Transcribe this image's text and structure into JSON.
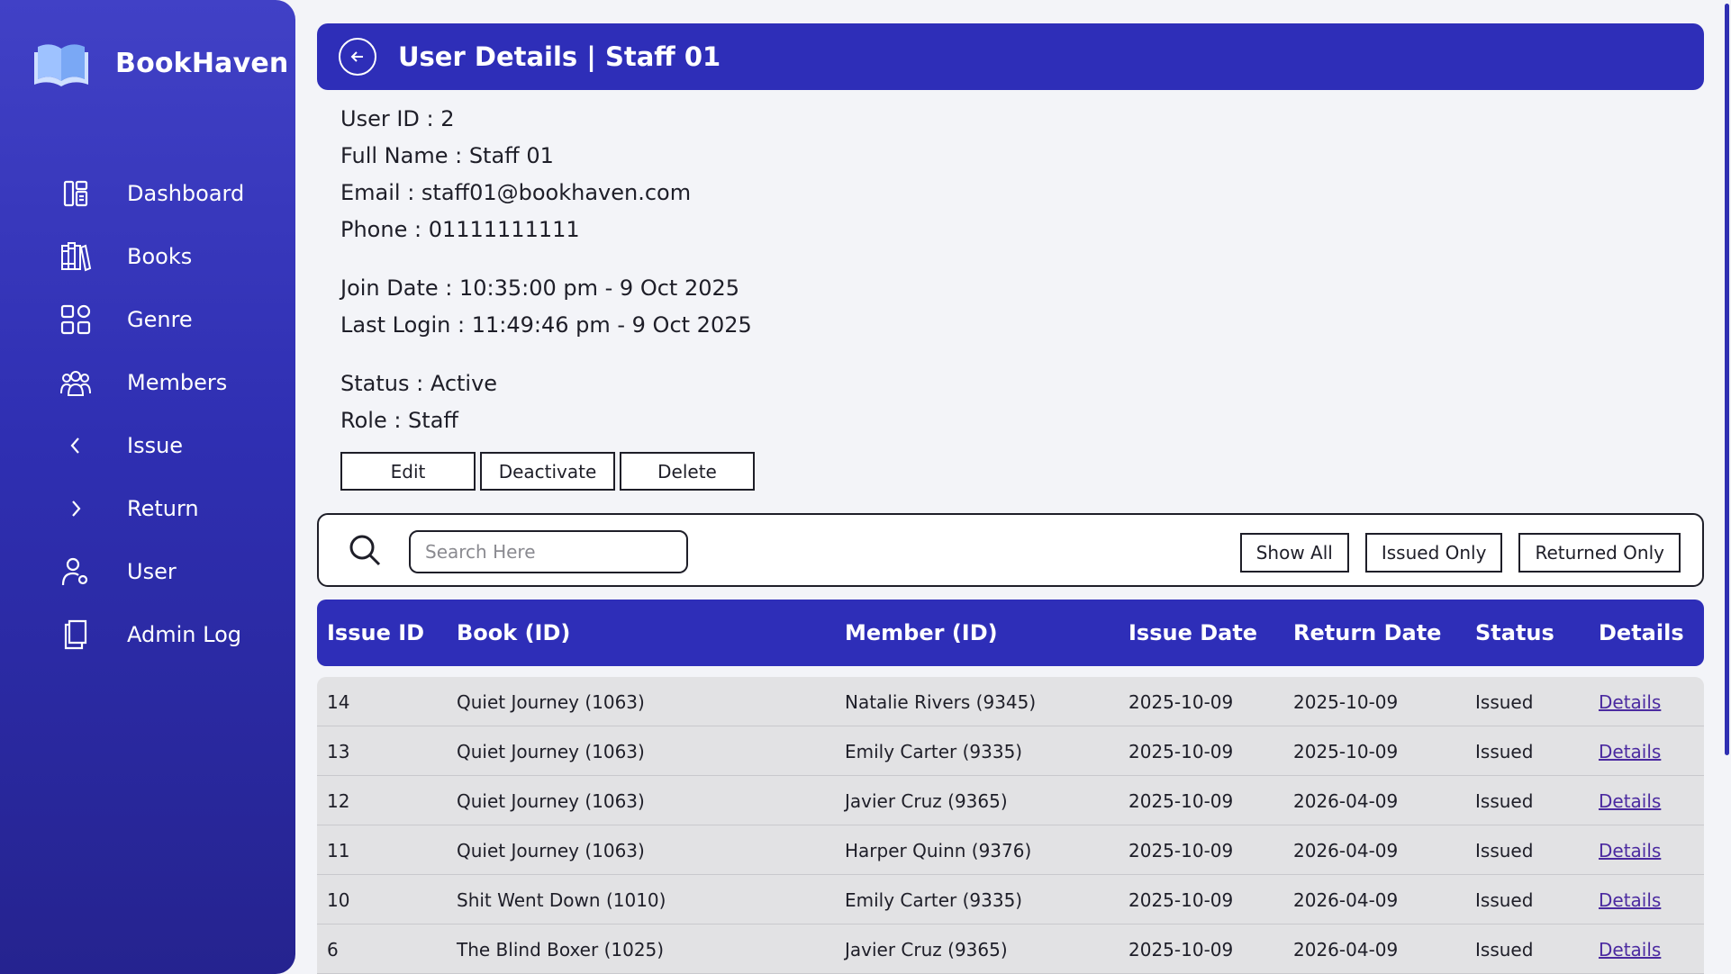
{
  "brand": {
    "name": "BookHaven"
  },
  "sidebar": {
    "items": [
      {
        "label": "Dashboard",
        "icon": "dashboard-icon"
      },
      {
        "label": "Books",
        "icon": "books-icon"
      },
      {
        "label": "Genre",
        "icon": "grid-icon"
      },
      {
        "label": "Members",
        "icon": "members-icon"
      },
      {
        "label": "Issue",
        "icon": "chevron-left-icon"
      },
      {
        "label": "Return",
        "icon": "chevron-right-icon"
      },
      {
        "label": "User",
        "icon": "user-settings-icon"
      },
      {
        "label": "Admin Log",
        "icon": "log-icon"
      }
    ]
  },
  "header": {
    "title": "User Details | Staff 01"
  },
  "user": {
    "id": "User ID : 2",
    "full_name": "Full Name : Staff 01",
    "email": "Email : staff01@bookhaven.com",
    "phone": "Phone : 01111111111",
    "join_date": "Join Date : 10:35:00 pm - 9 Oct 2025",
    "last_login": "Last Login : 11:49:46 pm - 9 Oct 2025",
    "status": "Status : Active",
    "role": "Role : Staff"
  },
  "actions": {
    "edit": "Edit",
    "deactivate": "Deactivate",
    "delete": "Delete"
  },
  "search": {
    "placeholder": "Search Here",
    "value": "",
    "filters": [
      "Show All",
      "Issued Only",
      "Returned Only"
    ]
  },
  "table": {
    "headers": [
      "Issue ID",
      "Book (ID)",
      "Member (ID)",
      "Issue Date",
      "Return Date",
      "Status",
      "Details"
    ],
    "rows": [
      [
        "14",
        "Quiet Journey (1063)",
        "Natalie Rivers (9345)",
        "2025-10-09",
        "2025-10-09",
        "Issued",
        "Details"
      ],
      [
        "13",
        "Quiet Journey (1063)",
        "Emily Carter (9335)",
        "2025-10-09",
        "2025-10-09",
        "Issued",
        "Details"
      ],
      [
        "12",
        "Quiet Journey (1063)",
        "Javier Cruz (9365)",
        "2025-10-09",
        "2026-04-09",
        "Issued",
        "Details"
      ],
      [
        "11",
        "Quiet Journey (1063)",
        "Harper Quinn (9376)",
        "2025-10-09",
        "2026-04-09",
        "Issued",
        "Details"
      ],
      [
        "10",
        "Shit Went Down (1010)",
        "Emily Carter (9335)",
        "2025-10-09",
        "2026-04-09",
        "Issued",
        "Details"
      ],
      [
        "6",
        "The Blind Boxer (1025)",
        "Javier Cruz (9365)",
        "2025-10-09",
        "2026-04-09",
        "Issued",
        "Details"
      ]
    ]
  },
  "colors": {
    "accent": "#2e2eb8",
    "sidebar_top": "#4141c6",
    "sidebar_bottom": "#25238f",
    "link": "#4b2aa0"
  }
}
